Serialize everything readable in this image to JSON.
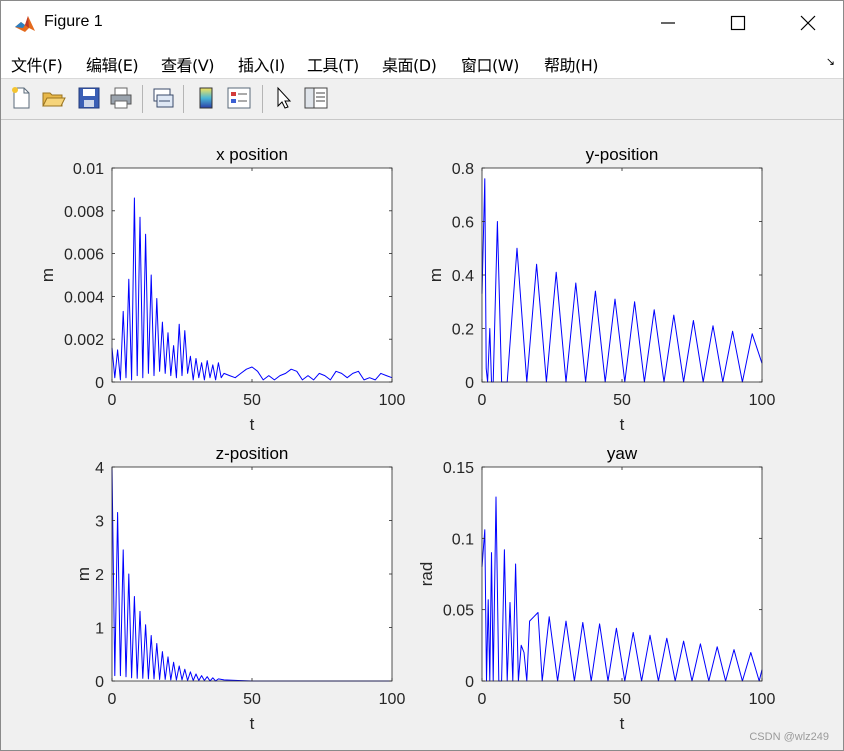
{
  "window": {
    "title": "Figure 1"
  },
  "menu": [
    "文件(F)",
    "编辑(E)",
    "查看(V)",
    "插入(I)",
    "工具(T)",
    "桌面(D)",
    "窗口(W)",
    "帮助(H)"
  ],
  "toolbar": [
    "new-figure-icon",
    "open-file-icon",
    "save-icon",
    "print-icon",
    "link-plot-icon",
    "insert-colorbar-icon",
    "insert-legend-icon",
    "edit-plot-arrow-icon",
    "property-inspector-icon"
  ],
  "colors": {
    "line": "#0000ff",
    "axes_bg": "#ffffff",
    "figure_bg": "#f0f0f0"
  },
  "watermark": "CSDN @wlz249",
  "chart_data": [
    {
      "type": "line",
      "title": "x position",
      "xlabel": "t",
      "ylabel": "m",
      "xlim": [
        0,
        100
      ],
      "ylim": [
        0,
        0.01
      ],
      "xticks": [
        "0",
        "50",
        "100"
      ],
      "yticks": [
        "0",
        "0.002",
        "0.004",
        "0.006",
        "0.008",
        "0.01"
      ],
      "grid": false,
      "x": [
        0,
        1,
        2,
        3,
        4,
        5,
        6,
        7,
        8,
        9,
        10,
        11,
        12,
        13,
        14,
        15,
        16,
        17,
        18,
        19,
        20,
        21,
        22,
        23,
        24,
        25,
        26,
        27,
        28,
        29,
        30,
        31,
        32,
        33,
        34,
        35,
        36,
        37,
        38,
        39,
        40,
        42,
        44,
        46,
        48,
        50,
        52,
        54,
        56,
        58,
        60,
        62,
        64,
        66,
        68,
        70,
        72,
        74,
        76,
        78,
        80,
        82,
        84,
        86,
        88,
        90,
        92,
        94,
        96,
        98,
        100
      ],
      "y": [
        0.0016,
        0.0002,
        0.0015,
        0.0001,
        0.0033,
        0.0002,
        0.0048,
        0.0001,
        0.0086,
        0.0003,
        0.0077,
        0.0002,
        0.0069,
        0.0004,
        0.005,
        0.0003,
        0.0039,
        0.0005,
        0.0028,
        0.0004,
        0.0023,
        0.0003,
        0.0017,
        0.0002,
        0.0027,
        0.0003,
        0.0024,
        0.0004,
        0.0012,
        0.0001,
        0.0011,
        0.0002,
        0.0009,
        0.0001,
        0.001,
        0.0002,
        0.0008,
        0.0001,
        0.0009,
        0.0002,
        0.0004,
        0.0003,
        0.0002,
        0.0004,
        0.0006,
        0.0007,
        0.0005,
        0.0001,
        0.0003,
        0.0001,
        0.0003,
        0.0004,
        0.0006,
        0.0005,
        0.0001,
        0.0003,
        0.0001,
        0.0004,
        0.0003,
        0.0001,
        0.0005,
        0.0004,
        0.0002,
        0.0004,
        0.0005,
        0.0001,
        0.0002,
        0.0001,
        0.0004,
        0.0003,
        0.0002
      ]
    },
    {
      "type": "line",
      "title": "y-position",
      "xlabel": "t",
      "ylabel": "m",
      "xlim": [
        0,
        100
      ],
      "ylim": [
        0,
        0.8
      ],
      "xticks": [
        "0",
        "50",
        "100"
      ],
      "yticks": [
        "0",
        "0.2",
        "0.4",
        "0.6",
        "0.8"
      ],
      "grid": false,
      "x": [
        0,
        1.0,
        1.5,
        2.0,
        2.8,
        3.4,
        4.0,
        5.5,
        7.0,
        9.0,
        12.5,
        16.0,
        19.5,
        23.0,
        26.5,
        30.0,
        33.5,
        37.0,
        40.5,
        44.0,
        47.5,
        51.0,
        54.5,
        58.0,
        61.5,
        65.0,
        68.5,
        72.0,
        75.5,
        79.0,
        82.5,
        86.0,
        89.5,
        93.0,
        96.5,
        100.0
      ],
      "y": [
        0.33,
        0.76,
        0.05,
        0.0,
        0.2,
        0.0,
        0.0,
        0.6,
        0.0,
        0.0,
        0.5,
        0.0,
        0.44,
        0.0,
        0.41,
        0.0,
        0.37,
        0.0,
        0.34,
        0.0,
        0.31,
        0.0,
        0.3,
        0.0,
        0.27,
        0.0,
        0.25,
        0.0,
        0.23,
        0.0,
        0.21,
        0.0,
        0.19,
        0.0,
        0.18,
        0.07
      ]
    },
    {
      "type": "line",
      "title": "z-position",
      "xlabel": "t",
      "ylabel": "m",
      "xlim": [
        0,
        100
      ],
      "ylim": [
        0,
        4
      ],
      "xticks": [
        "0",
        "50",
        "100"
      ],
      "yticks": [
        "0",
        "1",
        "2",
        "3",
        "4"
      ],
      "grid": false,
      "x": [
        0,
        1.0,
        2.0,
        3.0,
        4.0,
        5.0,
        6.0,
        7.0,
        8.0,
        9.0,
        10.0,
        11.0,
        12.0,
        13.0,
        14.0,
        15.0,
        16.0,
        17.0,
        18.0,
        19.0,
        20.0,
        21.0,
        22.0,
        23.0,
        24.0,
        25.0,
        26.0,
        27.0,
        28.0,
        29.0,
        30.0,
        31.0,
        32.0,
        33.0,
        34.0,
        35.0,
        36.0,
        37.0,
        38.0,
        40.0,
        45.0,
        50.0,
        60.0,
        70.0,
        80.0,
        90.0,
        100.0
      ],
      "y": [
        4.0,
        0.1,
        3.15,
        0.1,
        2.45,
        0.08,
        2.0,
        0.06,
        1.58,
        0.05,
        1.3,
        0.05,
        1.05,
        0.04,
        0.85,
        0.04,
        0.7,
        0.03,
        0.55,
        0.03,
        0.45,
        0.02,
        0.35,
        0.02,
        0.28,
        0.02,
        0.22,
        0.01,
        0.17,
        0.01,
        0.13,
        0.01,
        0.1,
        0.01,
        0.08,
        0.0,
        0.06,
        0.0,
        0.04,
        0.02,
        0.01,
        0.0,
        0.0,
        0.0,
        0.0,
        0.0,
        0.0
      ]
    },
    {
      "type": "line",
      "title": "yaw",
      "xlabel": "t",
      "ylabel": "rad",
      "xlim": [
        0,
        100
      ],
      "ylim": [
        0,
        0.15
      ],
      "xticks": [
        "0",
        "50",
        "100"
      ],
      "yticks": [
        "0",
        "0.05",
        "0.1",
        "0.15"
      ],
      "grid": false,
      "x": [
        0,
        1.0,
        1.6,
        2.2,
        2.8,
        3.4,
        4.0,
        5.0,
        6.0,
        7.0,
        8.0,
        9.0,
        10.0,
        11.0,
        12.0,
        13.0,
        14.0,
        15.0,
        16.0,
        17.0,
        18.5,
        20.0,
        21.5,
        24.0,
        27.0,
        30.0,
        33.0,
        36.0,
        39.0,
        42.0,
        45.0,
        48.0,
        51.0,
        54.0,
        57.0,
        60.0,
        63.0,
        66.0,
        69.0,
        72.0,
        75.0,
        78.0,
        81.0,
        84.0,
        87.0,
        90.0,
        93.0,
        96.0,
        99.0,
        100.0
      ],
      "y": [
        0.08,
        0.106,
        0.0,
        0.057,
        0.0,
        0.09,
        0.0,
        0.129,
        0.0,
        0.0,
        0.092,
        0.0,
        0.055,
        0.0,
        0.082,
        0.0,
        0.025,
        0.02,
        0.0,
        0.042,
        0.045,
        0.048,
        0.0,
        0.045,
        0.0,
        0.042,
        0.0,
        0.041,
        0.0,
        0.04,
        0.0,
        0.037,
        0.0,
        0.034,
        0.0,
        0.032,
        0.0,
        0.03,
        0.0,
        0.028,
        0.0,
        0.026,
        0.0,
        0.024,
        0.0,
        0.022,
        0.0,
        0.02,
        0.0,
        0.008
      ]
    }
  ]
}
